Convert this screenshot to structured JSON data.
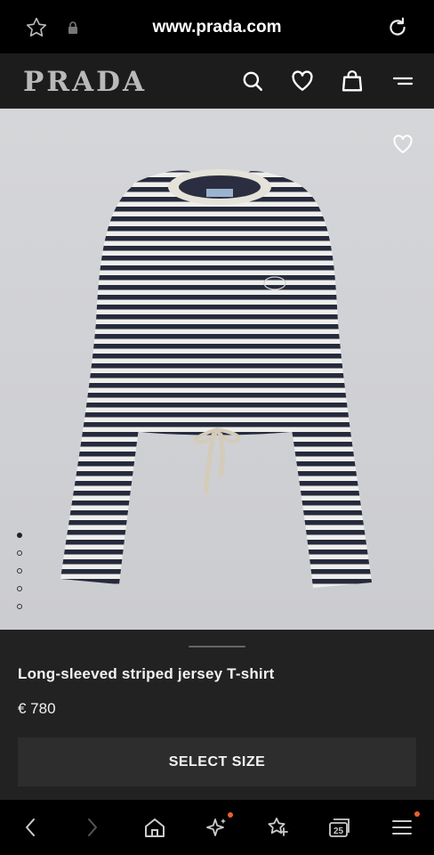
{
  "browser": {
    "url": "www.prada.com",
    "icons": [
      "star-outline-icon",
      "lock-icon",
      "reload-icon"
    ]
  },
  "site_header": {
    "logo": "PRADA",
    "icons": [
      "search-icon",
      "heart-icon",
      "shopping-bag-icon",
      "menu-icon"
    ]
  },
  "gallery": {
    "image_count": 5,
    "active_index": 0,
    "wishlist_icon": "heart-outline-icon"
  },
  "product": {
    "title": "Long-sleeved striped jersey T-shirt",
    "price": "€ 780",
    "select_size_label": "SELECT SIZE"
  },
  "bottom_nav": {
    "items": [
      "back-icon",
      "forward-icon",
      "home-icon",
      "sparkle-icon",
      "favorites-icon",
      "tabs-icon",
      "menu-icon"
    ],
    "tab_count": "25",
    "accent_color": "#e8622d"
  },
  "colors": {
    "header_bg": "#1c1c1c",
    "panel_bg": "#222222",
    "button_bg": "#2d2d2d",
    "image_bg": "#d2d3d6"
  }
}
